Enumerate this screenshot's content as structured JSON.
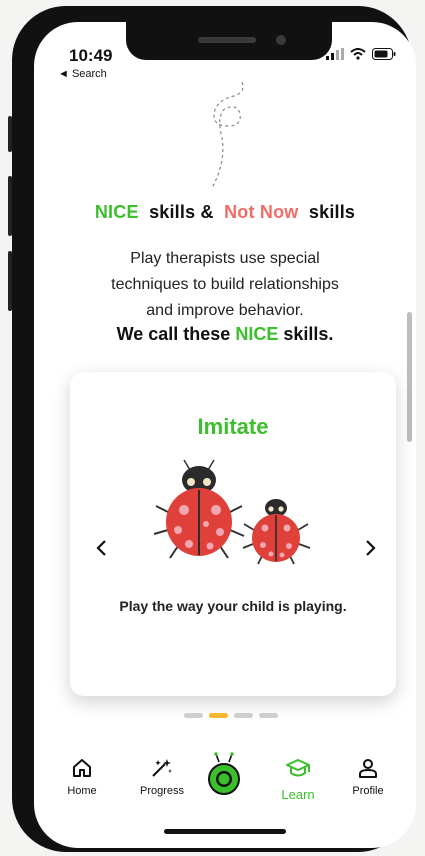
{
  "status": {
    "time": "10:49",
    "back_label": "◄ Search"
  },
  "heading": {
    "part1": "NICE",
    "part2": "skills &",
    "part3": "Not Now",
    "part4": "skills"
  },
  "intro": {
    "line1": "Play therapists use special",
    "line2": "techniques to build relationships",
    "line3": "and improve behavior.",
    "bold_prefix": "We call these",
    "bold_highlight": "NICE",
    "bold_suffix": "skills."
  },
  "card": {
    "title": "Imitate",
    "caption": "Play the way your child is playing.",
    "prev_icon": "chevron-left-icon",
    "next_icon": "chevron-right-icon"
  },
  "carousel": {
    "total": 4,
    "active_index": 1
  },
  "nav": {
    "items": [
      {
        "label": "Home",
        "icon": "home-icon"
      },
      {
        "label": "Progress",
        "icon": "sparkle-wand-icon"
      },
      {
        "label": "",
        "icon": "ladybug-center-icon"
      },
      {
        "label": "Learn",
        "icon": "graduation-cap-icon",
        "active": true
      },
      {
        "label": "Profile",
        "icon": "person-icon"
      }
    ]
  },
  "colors": {
    "accent_green": "#3bbf2c",
    "accent_coral": "#f36b66",
    "dot_active": "#f5b82e"
  }
}
